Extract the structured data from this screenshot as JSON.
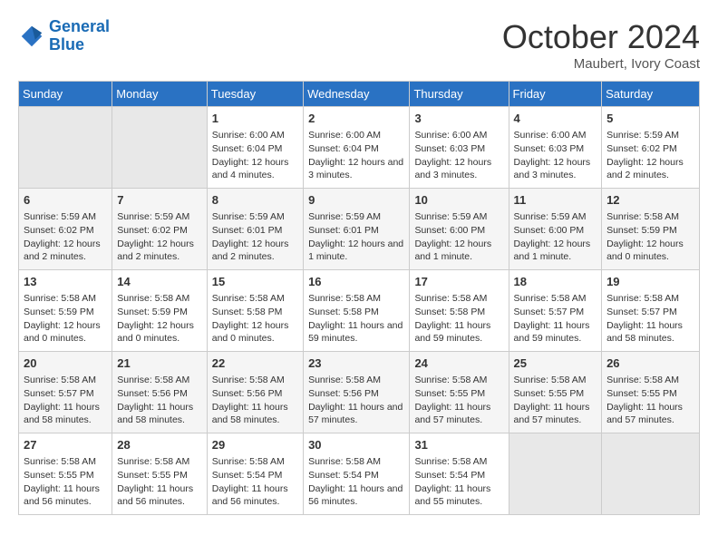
{
  "header": {
    "logo_line1": "General",
    "logo_line2": "Blue",
    "month": "October 2024",
    "location": "Maubert, Ivory Coast"
  },
  "columns": [
    "Sunday",
    "Monday",
    "Tuesday",
    "Wednesday",
    "Thursday",
    "Friday",
    "Saturday"
  ],
  "weeks": [
    [
      {
        "day": "",
        "empty": true
      },
      {
        "day": "",
        "empty": true
      },
      {
        "day": "1",
        "sunrise": "Sunrise: 6:00 AM",
        "sunset": "Sunset: 6:04 PM",
        "daylight": "Daylight: 12 hours and 4 minutes."
      },
      {
        "day": "2",
        "sunrise": "Sunrise: 6:00 AM",
        "sunset": "Sunset: 6:04 PM",
        "daylight": "Daylight: 12 hours and 3 minutes."
      },
      {
        "day": "3",
        "sunrise": "Sunrise: 6:00 AM",
        "sunset": "Sunset: 6:03 PM",
        "daylight": "Daylight: 12 hours and 3 minutes."
      },
      {
        "day": "4",
        "sunrise": "Sunrise: 6:00 AM",
        "sunset": "Sunset: 6:03 PM",
        "daylight": "Daylight: 12 hours and 3 minutes."
      },
      {
        "day": "5",
        "sunrise": "Sunrise: 5:59 AM",
        "sunset": "Sunset: 6:02 PM",
        "daylight": "Daylight: 12 hours and 2 minutes."
      }
    ],
    [
      {
        "day": "6",
        "sunrise": "Sunrise: 5:59 AM",
        "sunset": "Sunset: 6:02 PM",
        "daylight": "Daylight: 12 hours and 2 minutes."
      },
      {
        "day": "7",
        "sunrise": "Sunrise: 5:59 AM",
        "sunset": "Sunset: 6:02 PM",
        "daylight": "Daylight: 12 hours and 2 minutes."
      },
      {
        "day": "8",
        "sunrise": "Sunrise: 5:59 AM",
        "sunset": "Sunset: 6:01 PM",
        "daylight": "Daylight: 12 hours and 2 minutes."
      },
      {
        "day": "9",
        "sunrise": "Sunrise: 5:59 AM",
        "sunset": "Sunset: 6:01 PM",
        "daylight": "Daylight: 12 hours and 1 minute."
      },
      {
        "day": "10",
        "sunrise": "Sunrise: 5:59 AM",
        "sunset": "Sunset: 6:00 PM",
        "daylight": "Daylight: 12 hours and 1 minute."
      },
      {
        "day": "11",
        "sunrise": "Sunrise: 5:59 AM",
        "sunset": "Sunset: 6:00 PM",
        "daylight": "Daylight: 12 hours and 1 minute."
      },
      {
        "day": "12",
        "sunrise": "Sunrise: 5:58 AM",
        "sunset": "Sunset: 5:59 PM",
        "daylight": "Daylight: 12 hours and 0 minutes."
      }
    ],
    [
      {
        "day": "13",
        "sunrise": "Sunrise: 5:58 AM",
        "sunset": "Sunset: 5:59 PM",
        "daylight": "Daylight: 12 hours and 0 minutes."
      },
      {
        "day": "14",
        "sunrise": "Sunrise: 5:58 AM",
        "sunset": "Sunset: 5:59 PM",
        "daylight": "Daylight: 12 hours and 0 minutes."
      },
      {
        "day": "15",
        "sunrise": "Sunrise: 5:58 AM",
        "sunset": "Sunset: 5:58 PM",
        "daylight": "Daylight: 12 hours and 0 minutes."
      },
      {
        "day": "16",
        "sunrise": "Sunrise: 5:58 AM",
        "sunset": "Sunset: 5:58 PM",
        "daylight": "Daylight: 11 hours and 59 minutes."
      },
      {
        "day": "17",
        "sunrise": "Sunrise: 5:58 AM",
        "sunset": "Sunset: 5:58 PM",
        "daylight": "Daylight: 11 hours and 59 minutes."
      },
      {
        "day": "18",
        "sunrise": "Sunrise: 5:58 AM",
        "sunset": "Sunset: 5:57 PM",
        "daylight": "Daylight: 11 hours and 59 minutes."
      },
      {
        "day": "19",
        "sunrise": "Sunrise: 5:58 AM",
        "sunset": "Sunset: 5:57 PM",
        "daylight": "Daylight: 11 hours and 58 minutes."
      }
    ],
    [
      {
        "day": "20",
        "sunrise": "Sunrise: 5:58 AM",
        "sunset": "Sunset: 5:57 PM",
        "daylight": "Daylight: 11 hours and 58 minutes."
      },
      {
        "day": "21",
        "sunrise": "Sunrise: 5:58 AM",
        "sunset": "Sunset: 5:56 PM",
        "daylight": "Daylight: 11 hours and 58 minutes."
      },
      {
        "day": "22",
        "sunrise": "Sunrise: 5:58 AM",
        "sunset": "Sunset: 5:56 PM",
        "daylight": "Daylight: 11 hours and 58 minutes."
      },
      {
        "day": "23",
        "sunrise": "Sunrise: 5:58 AM",
        "sunset": "Sunset: 5:56 PM",
        "daylight": "Daylight: 11 hours and 57 minutes."
      },
      {
        "day": "24",
        "sunrise": "Sunrise: 5:58 AM",
        "sunset": "Sunset: 5:55 PM",
        "daylight": "Daylight: 11 hours and 57 minutes."
      },
      {
        "day": "25",
        "sunrise": "Sunrise: 5:58 AM",
        "sunset": "Sunset: 5:55 PM",
        "daylight": "Daylight: 11 hours and 57 minutes."
      },
      {
        "day": "26",
        "sunrise": "Sunrise: 5:58 AM",
        "sunset": "Sunset: 5:55 PM",
        "daylight": "Daylight: 11 hours and 57 minutes."
      }
    ],
    [
      {
        "day": "27",
        "sunrise": "Sunrise: 5:58 AM",
        "sunset": "Sunset: 5:55 PM",
        "daylight": "Daylight: 11 hours and 56 minutes."
      },
      {
        "day": "28",
        "sunrise": "Sunrise: 5:58 AM",
        "sunset": "Sunset: 5:55 PM",
        "daylight": "Daylight: 11 hours and 56 minutes."
      },
      {
        "day": "29",
        "sunrise": "Sunrise: 5:58 AM",
        "sunset": "Sunset: 5:54 PM",
        "daylight": "Daylight: 11 hours and 56 minutes."
      },
      {
        "day": "30",
        "sunrise": "Sunrise: 5:58 AM",
        "sunset": "Sunset: 5:54 PM",
        "daylight": "Daylight: 11 hours and 56 minutes."
      },
      {
        "day": "31",
        "sunrise": "Sunrise: 5:58 AM",
        "sunset": "Sunset: 5:54 PM",
        "daylight": "Daylight: 11 hours and 55 minutes."
      },
      {
        "day": "",
        "empty": true
      },
      {
        "day": "",
        "empty": true
      }
    ]
  ]
}
